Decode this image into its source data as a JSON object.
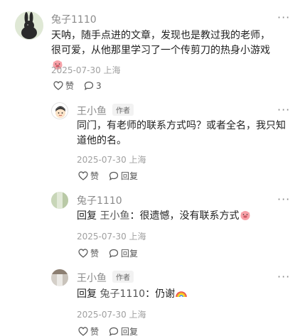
{
  "comment": {
    "author": "兔子1110",
    "text": "天呐，随手点进的文章，发现也是教过我的老师，很可爱，从他那里学习了一个传剪刀的热身小游戏",
    "date": "2025-07-30 上海",
    "like_label": "赞",
    "reply_count": "3",
    "more": "···"
  },
  "replies": [
    {
      "author": "王小鱼",
      "tag": "作者",
      "text": "同门，有老师的联系方式吗？或者全名，我只知道他的名。",
      "date": "2025-07-30 上海",
      "like_label": "赞",
      "reply_label": "回复",
      "more": "···"
    },
    {
      "author": "兔子1110",
      "reply_prefix": "回复",
      "reply_to": "王小鱼",
      "text": "：很遗憾，没有联系方式",
      "date": "2025-07-30 上海",
      "like_label": "赞",
      "reply_label": "回复",
      "more": "···"
    },
    {
      "author": "王小鱼",
      "tag": "作者",
      "reply_prefix": "回复",
      "reply_to": "兔子1110",
      "text": "：仍谢",
      "date": "2025-07-30 上海",
      "like_label": "赞",
      "reply_label": "回复",
      "more": "···"
    }
  ],
  "icons": {
    "like": "heart-outline-icon",
    "comment": "speech-bubble-icon",
    "more": "more-dots-icon",
    "emoji_pig": "pig-face-emoji",
    "emoji_rainbow": "rainbow-emoji"
  }
}
